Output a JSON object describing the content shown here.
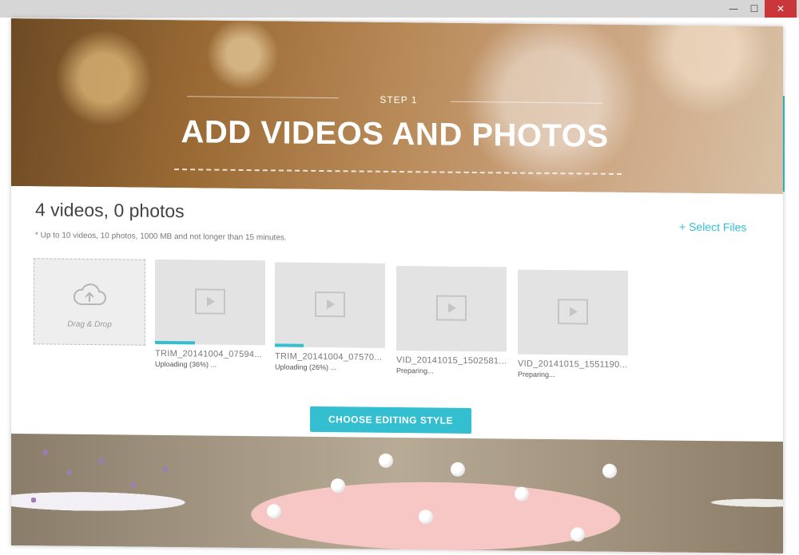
{
  "window": {
    "minimize_icon": "minimize-icon",
    "maximize_icon": "maximize-icon",
    "close_icon": "close-icon",
    "minimize_glyph": "—",
    "maximize_glyph": "☐",
    "close_glyph": "✕",
    "close_color": "#c9373a"
  },
  "hero": {
    "step": "STEP 1",
    "title": "ADD VIDEOS AND PHOTOS"
  },
  "summary": {
    "count": "4 videos, 0 photos",
    "limits": "* Up to 10 videos, 10 photos, 1000 MB and not longer than 15 minutes.",
    "select_files": "+ Select Files"
  },
  "drop_zone": {
    "label": "Drag & Drop",
    "icon": "cloud-upload-icon"
  },
  "videos": [
    {
      "name": "TRIM_20141004_07594...",
      "status": "Uploading (36%) ...",
      "progress": 0.36
    },
    {
      "name": "TRIM_20141004_07570...",
      "status": "Uploading (26%) ...",
      "progress": 0.26
    },
    {
      "name": "VID_20141015_1502581...",
      "status": "Preparing...",
      "progress": 0
    },
    {
      "name": "VID_20141015_1551190...",
      "status": "Preparing...",
      "progress": 0
    }
  ],
  "actions": {
    "choose_style": "CHOOSE EDITING STYLE"
  },
  "colors": {
    "accent": "#34bfd1",
    "thumb_bg": "#e3e3e3",
    "text": "#444444"
  }
}
